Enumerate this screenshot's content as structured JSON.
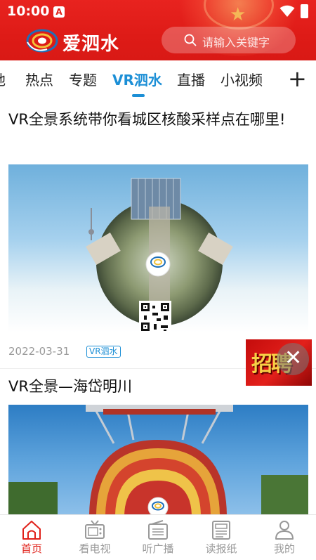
{
  "status_bar": {
    "time": "10:00",
    "notification_icon": "a-icon",
    "wifi_icon": "wifi-icon",
    "battery_icon": "battery-icon"
  },
  "header": {
    "app_name": "爱泗水",
    "search_placeholder": "请输入关键字",
    "brand_color": "#e02019"
  },
  "tabs": {
    "items": [
      {
        "label": "地"
      },
      {
        "label": "热点"
      },
      {
        "label": "专题"
      },
      {
        "label": "VR泗水",
        "active": true
      },
      {
        "label": "直播"
      },
      {
        "label": "小视频"
      }
    ],
    "add_label": "+",
    "accent_color": "#1c8fd6"
  },
  "feed": {
    "articles": [
      {
        "title": "VR全景系统带你看城区核酸采样点在哪里!",
        "date": "2022-03-31",
        "tag": "VR泗水",
        "image_icon": "vr-panorama-image"
      },
      {
        "title": "VR全景—海岱明川",
        "image_icon": "vr-panorama-image"
      }
    ]
  },
  "float_ad": {
    "text": "招聘",
    "close": "✕"
  },
  "bottom_nav": {
    "items": [
      {
        "label": "首页",
        "icon": "home-icon",
        "active": true
      },
      {
        "label": "看电视",
        "icon": "tv-icon"
      },
      {
        "label": "听广播",
        "icon": "radio-icon"
      },
      {
        "label": "读报纸",
        "icon": "newspaper-icon"
      },
      {
        "label": "我的",
        "icon": "user-icon"
      }
    ],
    "active_color": "#e02019",
    "inactive_color": "#999999"
  }
}
